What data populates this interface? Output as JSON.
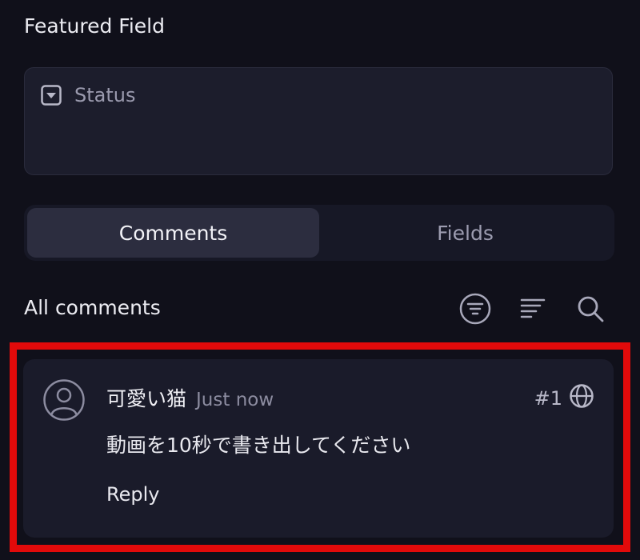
{
  "featured": {
    "title": "Featured Field",
    "status_label": "Status"
  },
  "tabs": [
    {
      "label": "Comments",
      "active": true
    },
    {
      "label": "Fields",
      "active": false
    }
  ],
  "comments_panel": {
    "title": "All comments",
    "actions": [
      "filter-icon",
      "sort-icon",
      "search-icon"
    ]
  },
  "comment": {
    "author": "可愛い猫",
    "time": "Just now",
    "id": "#1",
    "body": "動画を10秒で書き出してください",
    "reply_label": "Reply"
  },
  "colors": {
    "background": "#10101a",
    "card": "#1a1b2a",
    "highlight": "#e10a0a",
    "active_tab": "#2c2d3f"
  }
}
